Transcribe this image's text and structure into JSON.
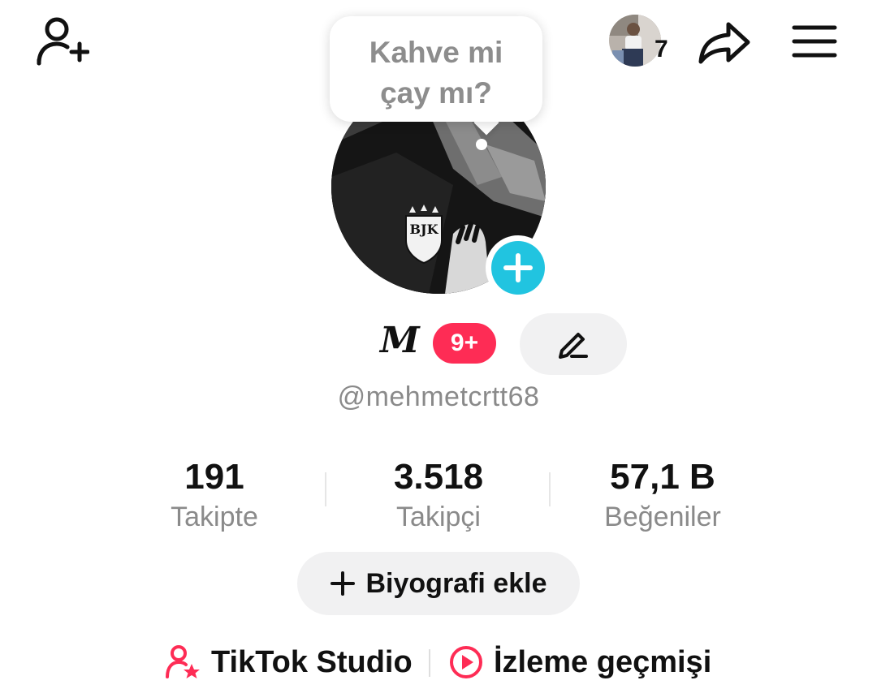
{
  "header": {
    "add_friend_icon": "person-plus-icon",
    "visitor_count": "7",
    "share_icon": "share-arrow-icon",
    "menu_icon": "hamburger-menu-icon"
  },
  "note_bubble": {
    "text_line1": "Kahve mi",
    "text_line2": "çay mı?"
  },
  "profile": {
    "name_glyph": "M",
    "notification_badge": "9+",
    "username": "@mehmetcrtt68"
  },
  "stats": {
    "following": {
      "value": "191",
      "label": "Takipte"
    },
    "followers": {
      "value": "3.518",
      "label": "Takipçi"
    },
    "likes": {
      "value": "57,1 B",
      "label": "Beğeniler"
    }
  },
  "bio_button": {
    "label": "Biyografi ekle"
  },
  "links": {
    "studio": {
      "label": "TikTok Studio"
    },
    "history": {
      "label": "İzleme geçmişi"
    }
  },
  "colors": {
    "accent_red": "#fe2c55",
    "accent_cyan": "#21c4e0",
    "muted_text": "#8a8a8a",
    "pill_bg": "#f1f1f2"
  }
}
